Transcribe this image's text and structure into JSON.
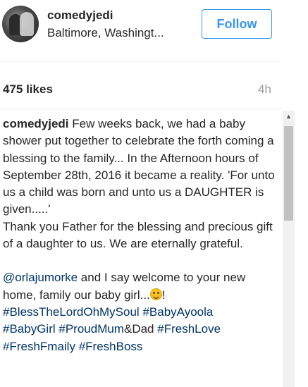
{
  "post_header": {
    "username": "comedyjedi",
    "location": "Baltimore, Washingt...",
    "follow_label": "Follow"
  },
  "stats": {
    "likes": "475 likes",
    "time_ago": "4h"
  },
  "caption": {
    "author": "comedyjedi",
    "paragraph1": " Few weeks back, we had a baby shower put together to celebrate the forth coming a blessing to the family... In the Afternoon hours of September 28th, 2016 it became a reality. 'For unto us a child was born and unto us a DAUGHTER is given.....'",
    "paragraph2": "Thank you Father for the blessing and precious gift of a daughter to us. We are eternally grateful.",
    "mention": "@orlajumorke",
    "paragraph3": " and I say welcome to your new home, family our baby girl...",
    "emoji_after": "!",
    "hashtags_line1": [
      "#BlessTheLordOhMySoul",
      "#BabyAyoola"
    ],
    "tag_babygirl": "#BabyGirl",
    "tag_proudmum": "#ProudMum",
    "text_and_dad": "&Dad",
    "tag_freshlove": "#FreshLove",
    "tag_freshfamily": "#FreshFmaily",
    "tag_freshboss": "#FreshBoss"
  },
  "scrollbar": {
    "up_arrow": "▲"
  },
  "colors": {
    "follow_blue": "#3897f0",
    "link_blue": "#003569",
    "muted_gray": "#999999"
  }
}
